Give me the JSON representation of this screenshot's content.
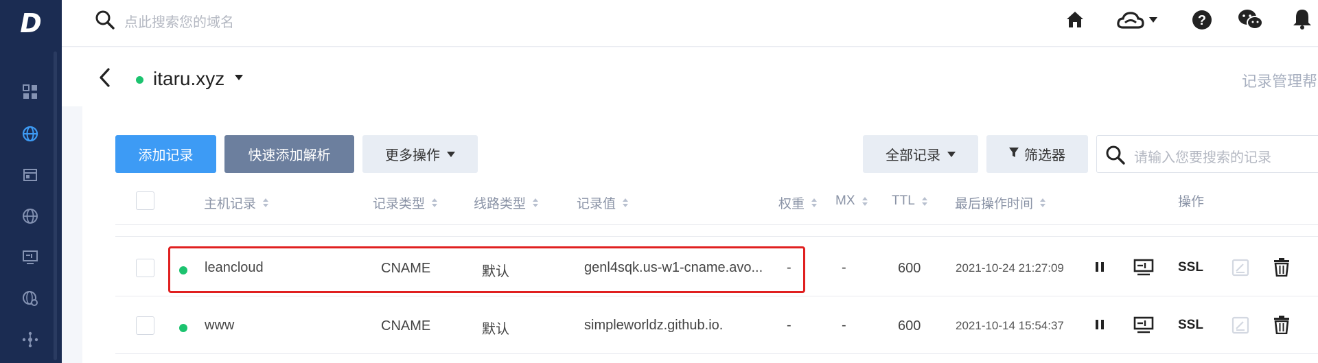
{
  "app": {
    "logo": "D"
  },
  "sidebar": {
    "items": [
      {
        "icon": "dashboard-icon"
      },
      {
        "icon": "globe-icon",
        "active": true
      },
      {
        "icon": "window-icon"
      },
      {
        "icon": "globe-outline-icon"
      },
      {
        "icon": "monitor-icon"
      },
      {
        "icon": "globe-settings-icon"
      },
      {
        "icon": "nodes-icon"
      }
    ]
  },
  "topbar": {
    "search_placeholder": "点此搜索您的域名",
    "icons": [
      "home-icon",
      "cloud-icon",
      "help-icon",
      "wechat-icon",
      "bell-icon"
    ]
  },
  "domain": {
    "name": "itaru.xyz",
    "status": "active",
    "help_link": "记录管理帮"
  },
  "toolbar": {
    "add_record": "添加记录",
    "quick_add": "快速添加解析",
    "more_actions": "更多操作",
    "all_records": "全部记录",
    "filter": "筛选器",
    "search_placeholder": "请输入您要搜索的记录"
  },
  "table": {
    "columns": {
      "host": "主机记录",
      "type": "记录类型",
      "line": "线路类型",
      "value": "记录值",
      "weight": "权重",
      "mx": "MX",
      "ttl": "TTL",
      "updated": "最后操作时间",
      "actions": "操作"
    },
    "rows": [
      {
        "host": "leancloud",
        "type": "CNAME",
        "line": "默认",
        "value": "genl4sqk.us-w1-cname.avo...",
        "weight": "-",
        "mx": "-",
        "ttl": "600",
        "updated": "2021-10-24 21:27:09",
        "ssl": "SSL",
        "highlighted": true
      },
      {
        "host": "www",
        "type": "CNAME",
        "line": "默认",
        "value": "simpleworldz.github.io.",
        "weight": "-",
        "mx": "-",
        "ttl": "600",
        "updated": "2021-10-14 15:54:37",
        "ssl": "SSL",
        "highlighted": false
      }
    ]
  },
  "colors": {
    "sidebar": "#1b2c52",
    "primary": "#3d9bf5",
    "status_ok": "#1cc36f",
    "highlight": "#e02020"
  }
}
